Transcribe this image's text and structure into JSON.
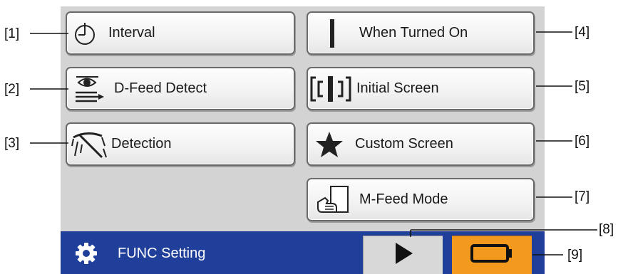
{
  "buttons": {
    "interval": "Interval",
    "dfeed": "D-Feed Detect",
    "detection": "Detection",
    "when_on": "When Turned On",
    "initial": "Initial Screen",
    "custom": "Custom Screen",
    "mfeed": "M-Feed Mode"
  },
  "status": {
    "title": "FUNC Setting"
  },
  "callouts": [
    "[1]",
    "[2]",
    "[3]",
    "[4]",
    "[5]",
    "[6]",
    "[7]",
    "[8]",
    "[9]"
  ],
  "icons": {
    "interval": "timer-icon",
    "dfeed": "eye-arrows-icon",
    "detection": "sensor-beam-icon",
    "when_on": "vertical-bar-icon",
    "initial": "screen-bracket-icon",
    "custom": "star-icon",
    "mfeed": "hand-document-icon",
    "settings": "gear-icon",
    "next": "play-triangle-icon",
    "device": "battery-outline-icon"
  },
  "colors": {
    "status_bar": "#1f3f9a",
    "orange_button": "#f39a1e",
    "screen_bg": "#d3d3d3"
  }
}
